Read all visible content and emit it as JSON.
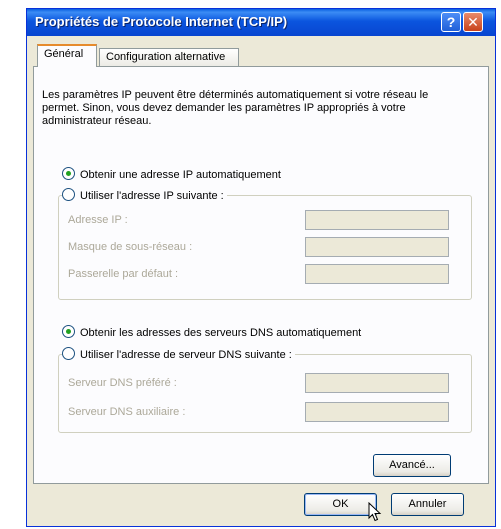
{
  "window": {
    "title": "Propriétés de Protocole Internet (TCP/IP)",
    "help_label": "?",
    "close_label": "✕"
  },
  "tabs": [
    {
      "label": "Général",
      "active": true
    },
    {
      "label": "Configuration alternative",
      "active": false
    }
  ],
  "intro": "Les paramètres IP peuvent être déterminés automatiquement si votre réseau le permet. Sinon, vous devez demander les paramètres IP appropriés à votre administrateur réseau.",
  "ip": {
    "auto_label": "Obtenir une adresse IP automatiquement",
    "manual_label": "Utiliser l'adresse IP suivante :",
    "selected": "auto",
    "fields": [
      {
        "label": "Adresse IP :",
        "value": ""
      },
      {
        "label": "Masque de sous-réseau :",
        "value": ""
      },
      {
        "label": "Passerelle par défaut :",
        "value": ""
      }
    ]
  },
  "dns": {
    "auto_label": "Obtenir les adresses des serveurs DNS automatiquement",
    "manual_label": "Utiliser l'adresse de serveur DNS suivante :",
    "selected": "auto",
    "fields": [
      {
        "label": "Serveur DNS préféré :",
        "value": ""
      },
      {
        "label": "Serveur DNS auxiliaire :",
        "value": ""
      }
    ]
  },
  "buttons": {
    "advanced": "Avancé...",
    "ok": "OK",
    "cancel": "Annuler"
  },
  "colors": {
    "titlebar": "#0b55de",
    "dialog_bg": "#ece9d8",
    "radio_dot": "#21a121",
    "tab_highlight": "#e68b2c"
  }
}
